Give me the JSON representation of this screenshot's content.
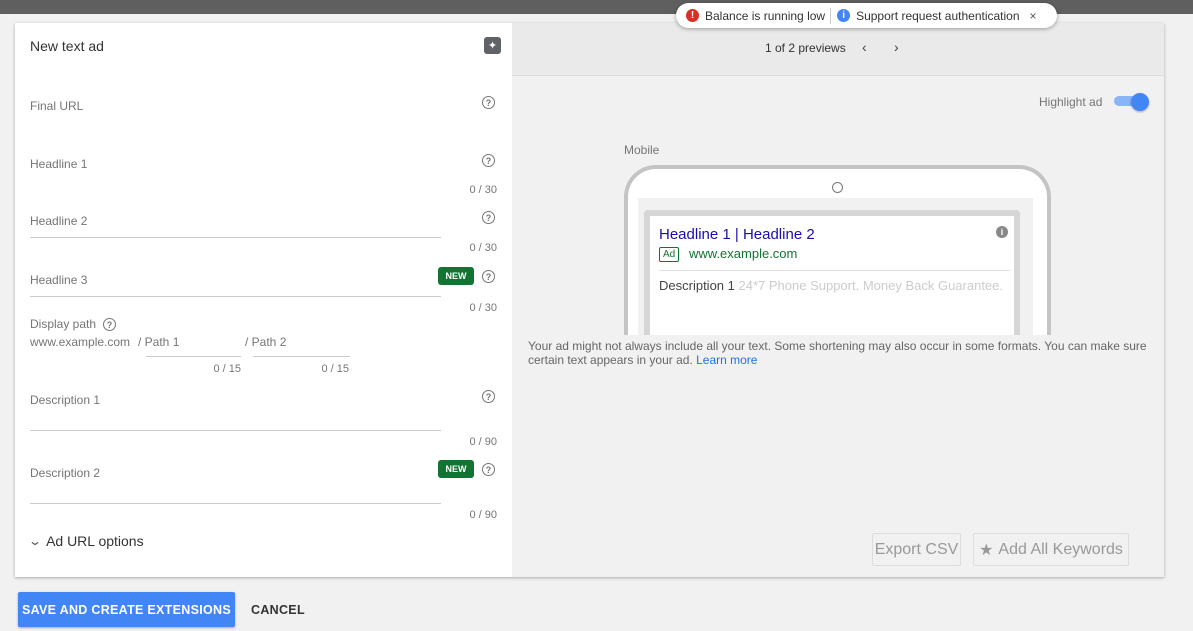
{
  "notifications": {
    "alert1": "Balance is running low",
    "alert2": "Support request authentication",
    "alert1_icon": "!",
    "alert2_icon": "i",
    "close": "×"
  },
  "form": {
    "title": "New text ad",
    "fields": {
      "final_url": {
        "label": "Final URL"
      },
      "headline1": {
        "label": "Headline 1",
        "count": "0 / 30"
      },
      "headline2": {
        "label": "Headline 2",
        "count": "0 / 30"
      },
      "headline3": {
        "label": "Headline 3",
        "count": "0 / 30",
        "badge": "NEW"
      },
      "display_path": {
        "label": "Display path",
        "prefix": "www.example.com",
        "path1": "/ Path 1",
        "path2": "/ Path 2",
        "path1_count": "0 / 15",
        "path2_count": "0 / 15"
      },
      "description1": {
        "label": "Description 1",
        "count": "0 / 90"
      },
      "description2": {
        "label": "Description 2",
        "count": "0 / 90",
        "badge": "NEW"
      }
    },
    "help_glyph": "?",
    "url_options": "Ad URL options"
  },
  "preview": {
    "counter": "1 of 2 previews",
    "prev": "‹",
    "next": "›",
    "highlight_label": "Highlight ad",
    "highlight_on": true,
    "device_label": "Mobile",
    "ad": {
      "headline": "Headline 1 | Headline 2",
      "badge": "Ad",
      "url": "www.example.com",
      "desc_main": "Description 1",
      "desc_faded": "24*7 Phone Support. Money Back Guarantee.",
      "info_glyph": "i"
    },
    "note": "Your ad might not always include all your text. Some shortening may also occur in some formats. You can make sure certain text appears in your ad.",
    "learn_more": "Learn more",
    "export_csv": "Export CSV",
    "add_keywords": "Add All Keywords"
  },
  "actions": {
    "save": "SAVE AND CREATE EXTENSIONS",
    "cancel": "CANCEL"
  },
  "colors": {
    "primary": "#4285f4",
    "new_badge": "#137333",
    "ad_headline": "#1a0dab",
    "ad_url": "#137333"
  }
}
